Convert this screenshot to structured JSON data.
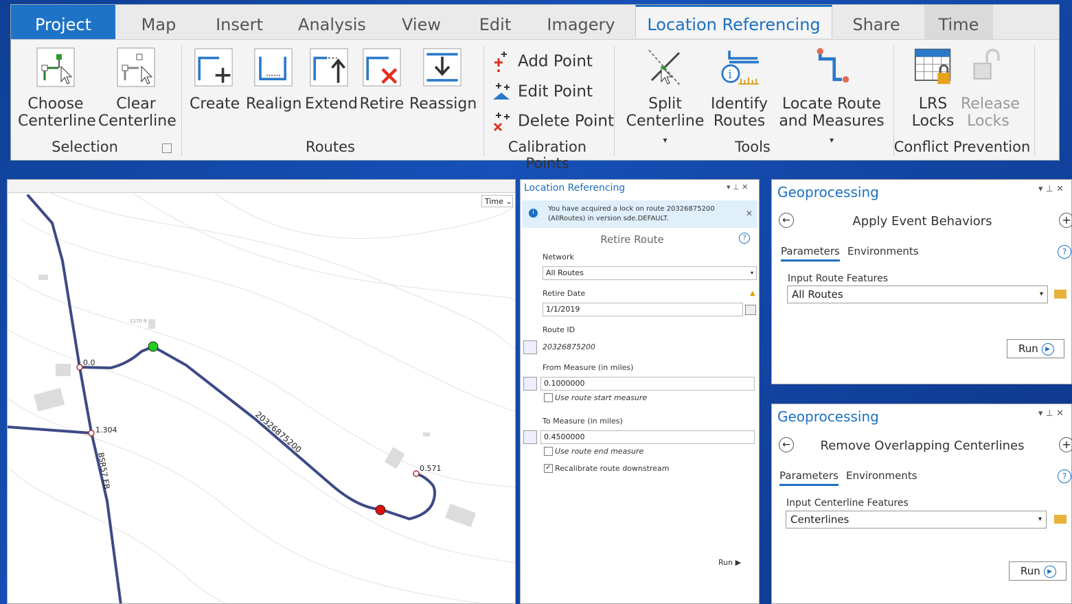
{
  "ribbon": {
    "tabs": [
      {
        "label": "Project",
        "state": "project"
      },
      {
        "label": "Map",
        "state": ""
      },
      {
        "label": "Insert",
        "state": ""
      },
      {
        "label": "Analysis",
        "state": ""
      },
      {
        "label": "View",
        "state": ""
      },
      {
        "label": "Edit",
        "state": ""
      },
      {
        "label": "Imagery",
        "state": ""
      },
      {
        "label": "Location Referencing",
        "state": "active"
      },
      {
        "label": "Share",
        "state": ""
      },
      {
        "label": "Time",
        "state": ""
      }
    ],
    "selection": {
      "choose": "Choose",
      "choose2": "Centerline",
      "clear": "Clear",
      "clear2": "Centerline",
      "group": "Selection"
    },
    "routes": {
      "create": "Create",
      "realign": "Realign",
      "extend": "Extend",
      "retire": "Retire",
      "reassign": "Reassign",
      "group": "Routes"
    },
    "calibration": {
      "add": "Add Point",
      "edit": "Edit Point",
      "delete": "Delete Point",
      "group": "Calibration Points"
    },
    "tools": {
      "split": "Split",
      "split2": "Centerline",
      "identify": "Identify",
      "identify2": "Routes",
      "locate": "Locate Route",
      "locate2": "and Measures",
      "group": "Tools"
    },
    "conflict": {
      "lrs": "LRS",
      "lrs2": "Locks",
      "release": "Release",
      "release2": "Locks",
      "group": "Conflict Prevention"
    }
  },
  "map": {
    "time_button": "Time",
    "route_label": "20326875200",
    "route_label2": "BSR57 EB",
    "measure_0": "0.0",
    "measure_1": "1.304",
    "measure_2": "0.571",
    "contour_label": "1270 ft"
  },
  "lr_panel": {
    "title": "Location Referencing",
    "lock_msg1": "You have acquired a lock on route 20326875200",
    "lock_msg2": "(AllRoutes) in version sde.DEFAULT.",
    "tool_title": "Retire Route",
    "network_label": "Network",
    "network_value": "All Routes",
    "retire_date_label": "Retire Date",
    "retire_date_value": "1/1/2019",
    "route_id_label": "Route ID",
    "route_id_value": "20326875200",
    "from_label": "From Measure (in miles)",
    "from_value": "0.1000000",
    "use_start": "Use route start measure",
    "to_label": "To Measure (in miles)",
    "to_value": "0.4500000",
    "use_end": "Use route end measure",
    "recalibrate": "Recalibrate route downstream",
    "run": "Run"
  },
  "gp1": {
    "title": "Geoprocessing",
    "tool": "Apply Event Behaviors",
    "tab_params": "Parameters",
    "tab_env": "Environments",
    "input_label": "Input Route Features",
    "input_value": "All Routes",
    "run": "Run"
  },
  "gp2": {
    "title": "Geoprocessing",
    "tool": "Remove Overlapping Centerlines",
    "tab_params": "Parameters",
    "tab_env": "Environments",
    "input_label": "Input Centerline Features",
    "input_value": "Centerlines",
    "run": "Run"
  },
  "colors": {
    "accent": "#1c6fc2",
    "route": "#3d4a85",
    "start_point": "#22cc22",
    "end_point": "#e01010"
  }
}
